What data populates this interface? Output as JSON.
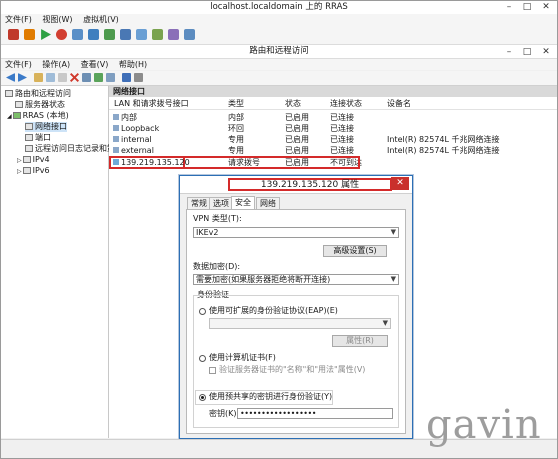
{
  "vm_window": {
    "title": "localhost.localdomain 上的 RRAS",
    "menu": [
      "文件(F)",
      "视图(W)",
      "虚拟机(V)"
    ],
    "controls": [
      "–",
      "□",
      "✕"
    ],
    "toolbar_icons": [
      "pause-icon",
      "stop-icon",
      "play-icon",
      "reset-icon",
      "ctrl-alt-del-icon",
      "snapshot-icon",
      "revert-icon",
      "save-icon",
      "settings-icon",
      "share-icon",
      "undo-icon",
      "help-icon"
    ]
  },
  "mmc": {
    "title": "路由和远程访问",
    "menu": [
      "文件(F)",
      "操作(A)",
      "查看(V)",
      "帮助(H)"
    ],
    "controls": [
      "–",
      "□",
      "✕"
    ]
  },
  "tree": {
    "items": [
      {
        "label": "路由和远程访问",
        "icon": "rras-icon"
      },
      {
        "label": "服务器状态",
        "icon": "server-status-icon"
      },
      {
        "label": "RRAS (本地)",
        "icon": "server-icon"
      },
      {
        "label": "网络接口",
        "icon": "network-interface-icon"
      },
      {
        "label": "端口",
        "icon": "ports-icon"
      },
      {
        "label": "远程访问日志记录和策略",
        "icon": "log-icon"
      },
      {
        "label": "IPv4",
        "icon": "ipv4-icon"
      },
      {
        "label": "IPv6",
        "icon": "ipv6-icon"
      }
    ]
  },
  "list": {
    "header": "网络接口",
    "columns": [
      "LAN 和请求拨号接口",
      "类型",
      "状态",
      "连接状态",
      "设备名"
    ],
    "rows": [
      {
        "name": "内部",
        "type": "内部",
        "status": "已启用",
        "conn": "已连接",
        "device": ""
      },
      {
        "name": "Loopback",
        "type": "环回",
        "status": "已启用",
        "conn": "已连接",
        "device": ""
      },
      {
        "name": "internal",
        "type": "专用",
        "status": "已启用",
        "conn": "已连接",
        "device": "Intel(R) 82574L 千兆网络连接"
      },
      {
        "name": "external",
        "type": "专用",
        "status": "已启用",
        "conn": "已连接",
        "device": "Intel(R) 82574L 千兆网络连接"
      },
      {
        "name": "139.219.135.120",
        "type": "请求拨号",
        "status": "已启用",
        "conn": "不可到达",
        "device": ""
      }
    ]
  },
  "dialog": {
    "title": "139.219.135.120 属性",
    "close": "✕",
    "tabs": [
      "常规",
      "选项",
      "安全",
      "网络"
    ],
    "vpn_type_label": "VPN 类型(T):",
    "vpn_type_value": "IKEv2",
    "advanced_button": "高级设置(S)",
    "encryption_label": "数据加密(D):",
    "encryption_value": "需要加密(如果服务器拒绝将断开连接)",
    "auth_group_label": "身份验证",
    "eap_option": "使用可扩展的身份验证协议(EAP)(E)",
    "properties_button": "属性(R)",
    "cert_option": "使用计算机证书(F)",
    "verify_cert_option": "验证服务器证书的\"名称\"和\"用法\"属性(V)",
    "psk_option": "使用预共享的密钥进行身份验证(Y)",
    "key_label": "密钥(K):",
    "key_value": "••••••••••••••••••"
  },
  "watermark": "gavin",
  "colors": {
    "highlight": "#d42a2a",
    "selection": "#cde3f7",
    "dialog_border": "#2c6fb5",
    "close_button": "#c9302c"
  }
}
